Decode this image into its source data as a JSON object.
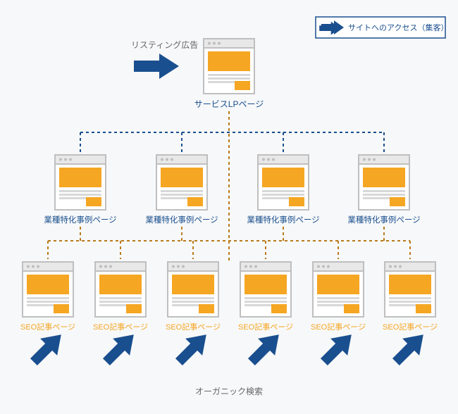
{
  "legend": {
    "label": "サイトへのアクセス（集客）"
  },
  "traffic": {
    "listing_label": "リスティング広告",
    "organic_label": "オーガニック検索"
  },
  "lp": {
    "label": "サービスLPページ"
  },
  "industry_pages": [
    {
      "label": "業種特化事例ページ"
    },
    {
      "label": "業種特化事例ページ"
    },
    {
      "label": "業種特化事例ページ"
    },
    {
      "label": "業種特化事例ページ"
    }
  ],
  "seo_pages": [
    {
      "label": "SEO記事ページ"
    },
    {
      "label": "SEO記事ページ"
    },
    {
      "label": "SEO記事ページ"
    },
    {
      "label": "SEO記事ページ"
    },
    {
      "label": "SEO記事ページ"
    },
    {
      "label": "SEO記事ページ"
    }
  ],
  "colors": {
    "blue": "#1a4f8f",
    "orange": "#f5a623",
    "orange_dark": "#b97a1a",
    "gray": "#bfbfbf",
    "gray_light": "#cfcfcf",
    "text_dark": "#666666"
  }
}
